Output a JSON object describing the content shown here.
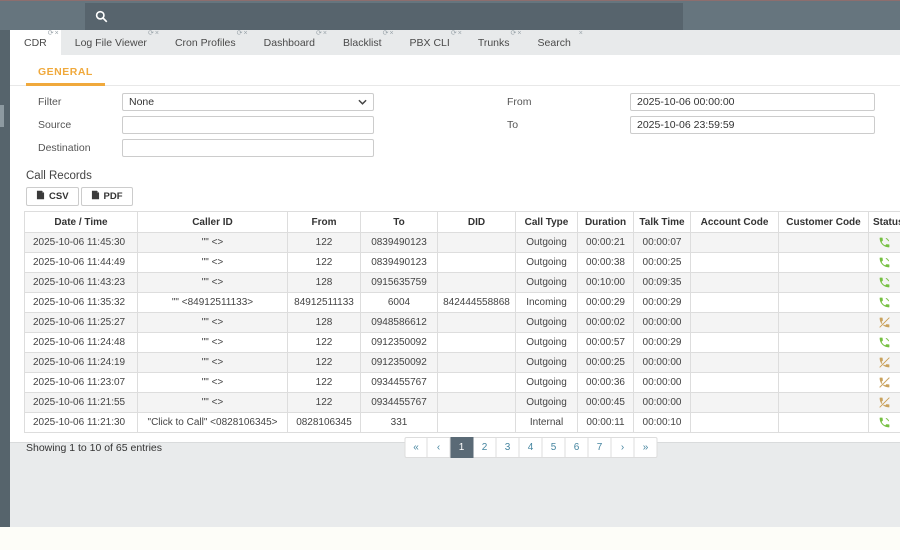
{
  "topbar": {
    "search_value": ""
  },
  "tabs": [
    {
      "label": "CDR",
      "active": true,
      "refreshable": true
    },
    {
      "label": "Log File Viewer",
      "active": false,
      "refreshable": true
    },
    {
      "label": "Cron Profiles",
      "active": false,
      "refreshable": true
    },
    {
      "label": "Dashboard",
      "active": false,
      "refreshable": true
    },
    {
      "label": "Blacklist",
      "active": false,
      "refreshable": true
    },
    {
      "label": "PBX CLI",
      "active": false,
      "refreshable": true
    },
    {
      "label": "Trunks",
      "active": false,
      "refreshable": true
    },
    {
      "label": "Search",
      "active": false,
      "refreshable": false
    }
  ],
  "panel": {
    "section_label": "GENERAL",
    "filters": {
      "filter_label": "Filter",
      "filter_value": "None",
      "source_label": "Source",
      "source_value": "",
      "destination_label": "Destination",
      "destination_value": "",
      "from_label": "From",
      "from_value": "2025-10-06 00:00:00",
      "to_label": "To",
      "to_value": "2025-10-06 23:59:59"
    },
    "call_records": {
      "title": "Call Records",
      "csv_label": "CSV",
      "pdf_label": "PDF",
      "columns": [
        "Date / Time",
        "Caller ID",
        "From",
        "To",
        "DID",
        "Call Type",
        "Duration",
        "Talk Time",
        "Account Code",
        "Customer Code",
        "Status"
      ],
      "records": [
        {
          "date_time": "2025-10-06 11:45:30",
          "caller_id": "\"\" <>",
          "from": "122",
          "to": "0839490123",
          "did": "",
          "call_type": "Outgoing",
          "duration": "00:00:21",
          "talk_time": "00:00:07",
          "account_code": "",
          "customer_code": "",
          "status": "answered"
        },
        {
          "date_time": "2025-10-06 11:44:49",
          "caller_id": "\"\" <>",
          "from": "122",
          "to": "0839490123",
          "did": "",
          "call_type": "Outgoing",
          "duration": "00:00:38",
          "talk_time": "00:00:25",
          "account_code": "",
          "customer_code": "",
          "status": "answered"
        },
        {
          "date_time": "2025-10-06 11:43:23",
          "caller_id": "\"\" <>",
          "from": "128",
          "to": "0915635759",
          "did": "",
          "call_type": "Outgoing",
          "duration": "00:10:00",
          "talk_time": "00:09:35",
          "account_code": "",
          "customer_code": "",
          "status": "answered"
        },
        {
          "date_time": "2025-10-06 11:35:32",
          "caller_id": "\"\" <84912511133>",
          "from": "84912511133",
          "to": "6004",
          "did": "842444558868",
          "call_type": "Incoming",
          "duration": "00:00:29",
          "talk_time": "00:00:29",
          "account_code": "",
          "customer_code": "",
          "status": "answered"
        },
        {
          "date_time": "2025-10-06 11:25:27",
          "caller_id": "\"\" <>",
          "from": "128",
          "to": "0948586612",
          "did": "",
          "call_type": "Outgoing",
          "duration": "00:00:02",
          "talk_time": "00:00:00",
          "account_code": "",
          "customer_code": "",
          "status": "missed"
        },
        {
          "date_time": "2025-10-06 11:24:48",
          "caller_id": "\"\" <>",
          "from": "122",
          "to": "0912350092",
          "did": "",
          "call_type": "Outgoing",
          "duration": "00:00:57",
          "talk_time": "00:00:29",
          "account_code": "",
          "customer_code": "",
          "status": "answered"
        },
        {
          "date_time": "2025-10-06 11:24:19",
          "caller_id": "\"\" <>",
          "from": "122",
          "to": "0912350092",
          "did": "",
          "call_type": "Outgoing",
          "duration": "00:00:25",
          "talk_time": "00:00:00",
          "account_code": "",
          "customer_code": "",
          "status": "missed"
        },
        {
          "date_time": "2025-10-06 11:23:07",
          "caller_id": "\"\" <>",
          "from": "122",
          "to": "0934455767",
          "did": "",
          "call_type": "Outgoing",
          "duration": "00:00:36",
          "talk_time": "00:00:00",
          "account_code": "",
          "customer_code": "",
          "status": "missed"
        },
        {
          "date_time": "2025-10-06 11:21:55",
          "caller_id": "\"\" <>",
          "from": "122",
          "to": "0934455767",
          "did": "",
          "call_type": "Outgoing",
          "duration": "00:00:45",
          "talk_time": "00:00:00",
          "account_code": "",
          "customer_code": "",
          "status": "missed"
        },
        {
          "date_time": "2025-10-06 11:21:30",
          "caller_id": "\"Click to Call\" <0828106345>",
          "from": "0828106345",
          "to": "331",
          "did": "",
          "call_type": "Internal",
          "duration": "00:00:11",
          "talk_time": "00:00:10",
          "account_code": "",
          "customer_code": "",
          "status": "answered"
        }
      ],
      "summary": "Showing 1 to 10 of 65 entries",
      "pagination": {
        "pages": [
          "«",
          "‹",
          "1",
          "2",
          "3",
          "4",
          "5",
          "6",
          "7",
          "›",
          "»"
        ],
        "active": "1"
      }
    }
  },
  "colors": {
    "topbar_bg": "#66757e",
    "search_bg": "#57646d",
    "strip_bg": "#56646c",
    "tabbar_bg": "#e8eaeb",
    "general_accent": "#f0a93c",
    "answered": "#76c043",
    "missed": "#c9a25e",
    "page_active_bg": "#5a6a76",
    "page_link": "#4585a0"
  }
}
